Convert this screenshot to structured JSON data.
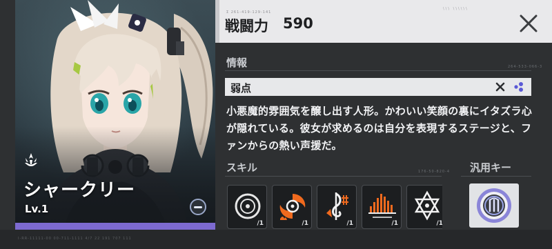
{
  "character": {
    "name": "シャークリー",
    "level": "Lv.1",
    "class_icon": "class-emblem-icon"
  },
  "header": {
    "power_label": "戦闘力",
    "power_value": "590",
    "micro_code": "Σ 261-419-129-141",
    "micro_code2": "\\\\\\  \\\\\\\\\\\\"
  },
  "info": {
    "title": "情報",
    "code": "264-533-066-3",
    "tag": "弱点",
    "description": "小悪魔的雰囲気を醸し出す人形。かわいい笑顔の裏にイタズラ心が隠れている。彼女が求めるのは自分を表現するステージと、ファンからの熱い声援だ。"
  },
  "skills": {
    "title": "スキル",
    "code": "176-50-820-4",
    "items": [
      {
        "icon": "target-ring-icon",
        "count": "/1"
      },
      {
        "icon": "fire-vortex-icon",
        "count": "/1"
      },
      {
        "icon": "music-note-icon",
        "count": "/1"
      },
      {
        "icon": "sound-wave-icon",
        "count": "/1"
      },
      {
        "icon": "star-emblem-icon",
        "count": "/1"
      }
    ]
  },
  "general_key": {
    "title": "汎用キー",
    "icon": "key-core-icon"
  },
  "footer": {
    "micro_code": "I-RR-11111-00 00-711-1111 4/7  22   191  707  111"
  },
  "colors": {
    "level_bar": "#7d6ad0",
    "fire_accent": "#f06a1e",
    "header_bg": "#e9e9eb"
  }
}
